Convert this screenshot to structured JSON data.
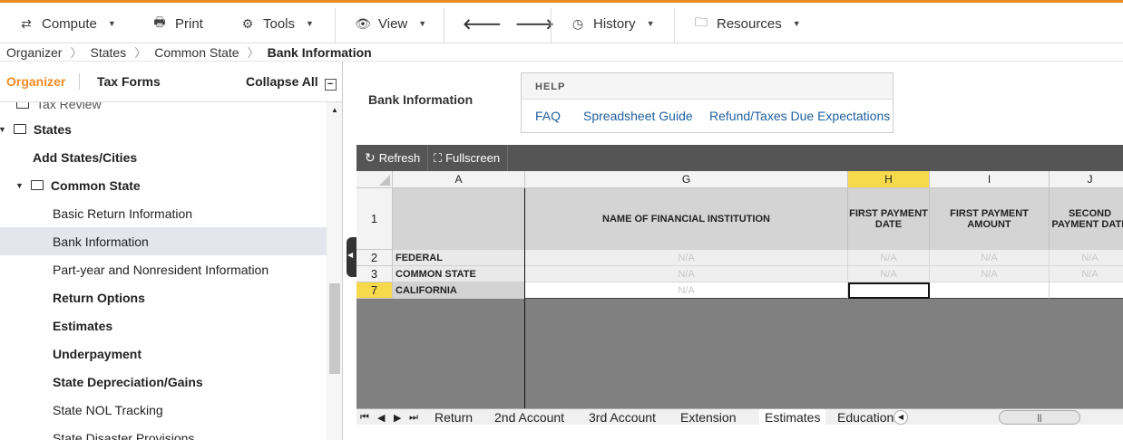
{
  "toolbar": {
    "compute": "Compute",
    "print": "Print",
    "tools": "Tools",
    "view": "View",
    "history": "History",
    "resources": "Resources",
    "back_icon": "arrow-left-icon",
    "forward_icon": "arrow-right-icon"
  },
  "breadcrumb": [
    "Organizer",
    "States",
    "Common State",
    "Bank Information"
  ],
  "left": {
    "tab_organizer": "Organizer",
    "tab_taxforms": "Tax Forms",
    "collapse_all": "Collapse All",
    "tree": [
      {
        "label": "Tax Review"
      },
      {
        "label": "States"
      },
      {
        "label": "Add States/Cities"
      },
      {
        "label": "Common State"
      },
      {
        "label": "Basic Return Information"
      },
      {
        "label": "Bank Information"
      },
      {
        "label": "Part-year and Nonresident Information"
      },
      {
        "label": "Return Options"
      },
      {
        "label": "Estimates"
      },
      {
        "label": "Underpayment"
      },
      {
        "label": "State Depreciation/Gains"
      },
      {
        "label": "State NOL Tracking"
      },
      {
        "label": "State Disaster Provisions"
      }
    ]
  },
  "main": {
    "title": "Bank Information",
    "help": {
      "title": "HELP",
      "links": [
        "FAQ",
        "Spreadsheet Guide",
        "Refund/Taxes Due Expectations"
      ]
    }
  },
  "grid": {
    "refresh": "Refresh",
    "fullscreen": "Fullscreen",
    "columns": [
      "A",
      "G",
      "H",
      "I",
      "J"
    ],
    "row_headers": [
      "1",
      "2",
      "3",
      "7"
    ],
    "col_titles": [
      "",
      "NAME OF FINANCIAL INSTITUTION",
      "FIRST PAYMENT DATE",
      "FIRST PAYMENT AMOUNT",
      "SECOND PAYMENT DATE"
    ],
    "rows": [
      {
        "label": "FEDERAL",
        "cells": [
          "N/A",
          "N/A",
          "N/A",
          "N/A"
        ]
      },
      {
        "label": "COMMON STATE",
        "cells": [
          "N/A",
          "N/A",
          "N/A",
          "N/A"
        ]
      },
      {
        "label": "CALIFORNIA",
        "cells": [
          "N/A",
          "",
          "",
          ""
        ]
      }
    ],
    "sheet_tabs": [
      "Return",
      "2nd Account",
      "3rd Account",
      "Extension",
      "Estimates",
      "Education"
    ]
  }
}
